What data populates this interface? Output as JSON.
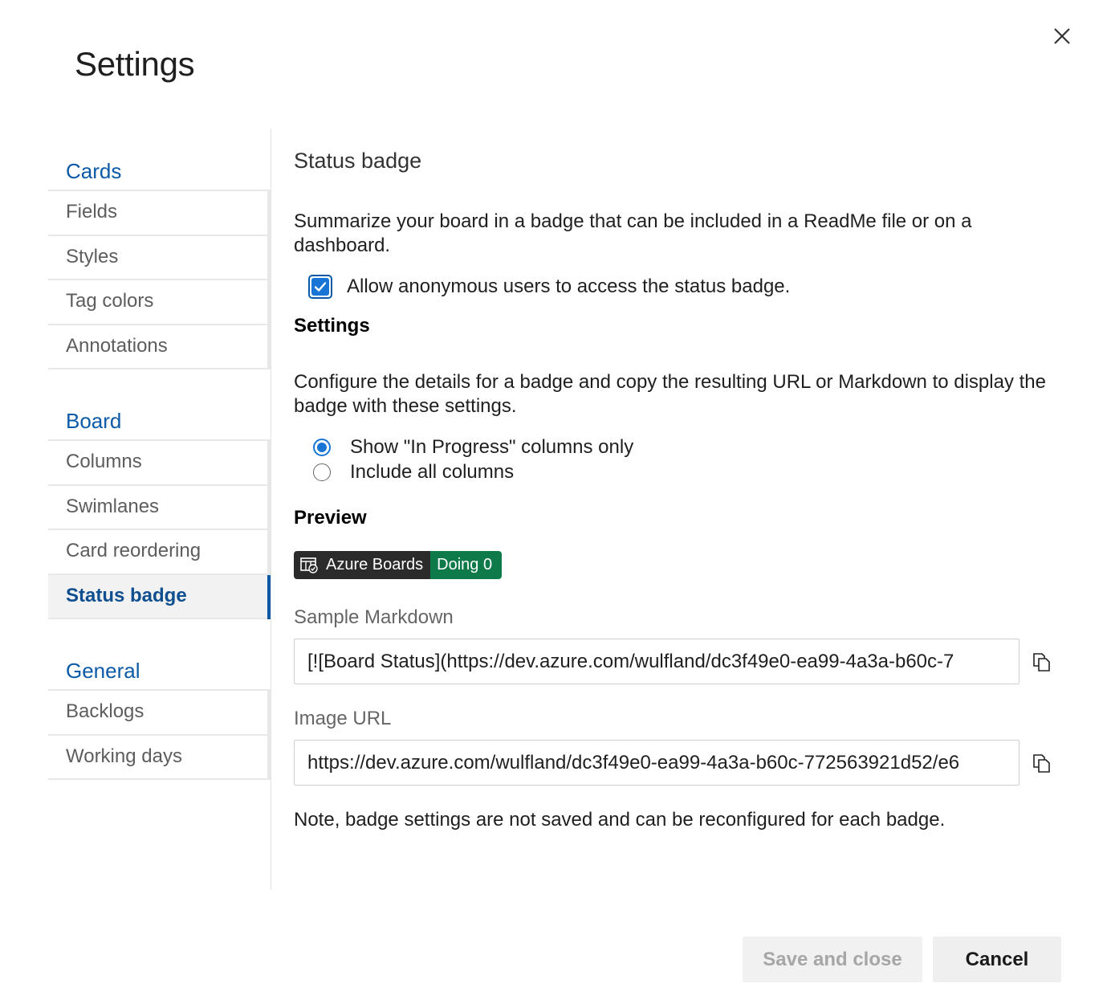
{
  "dialog": {
    "title": "Settings"
  },
  "sidebar": {
    "groups": [
      {
        "header": "Cards",
        "items": [
          "Fields",
          "Styles",
          "Tag colors",
          "Annotations"
        ]
      },
      {
        "header": "Board",
        "items": [
          "Columns",
          "Swimlanes",
          "Card reordering",
          "Status badge"
        ]
      },
      {
        "header": "General",
        "items": [
          "Backlogs",
          "Working days"
        ]
      }
    ],
    "selected": "Status badge"
  },
  "content": {
    "section_title": "Status badge",
    "description": "Summarize your board in a badge that can be included in a ReadMe file or on a dashboard.",
    "anonymous_checkbox": {
      "label": "Allow anonymous users to access the status badge.",
      "checked": true
    },
    "settings_heading": "Settings",
    "settings_description": "Configure the details for a badge and copy the resulting URL or Markdown to display the badge with these settings.",
    "radio_options": [
      {
        "label": "Show \"In Progress\" columns only",
        "selected": true
      },
      {
        "label": "Include all columns",
        "selected": false
      }
    ],
    "preview_heading": "Preview",
    "badge": {
      "left_text": "Azure Boards",
      "right_text": "Doing 0",
      "left_color": "#2b2b2b",
      "right_color": "#0e7a4a",
      "icon": "board-icon"
    },
    "sample_markdown": {
      "label": "Sample Markdown",
      "value": "[![Board Status](https://dev.azure.com/wulfland/dc3f49e0-ea99-4a3a-b60c-7"
    },
    "image_url": {
      "label": "Image URL",
      "value": "https://dev.azure.com/wulfland/dc3f49e0-ea99-4a3a-b60c-772563921d52/e6"
    },
    "note": "Note, badge settings are not saved and can be reconfigured for each badge."
  },
  "footer": {
    "save_label": "Save and close",
    "cancel_label": "Cancel"
  },
  "colors": {
    "accent": "#0a5aa8",
    "checkbox": "#1875d6"
  }
}
